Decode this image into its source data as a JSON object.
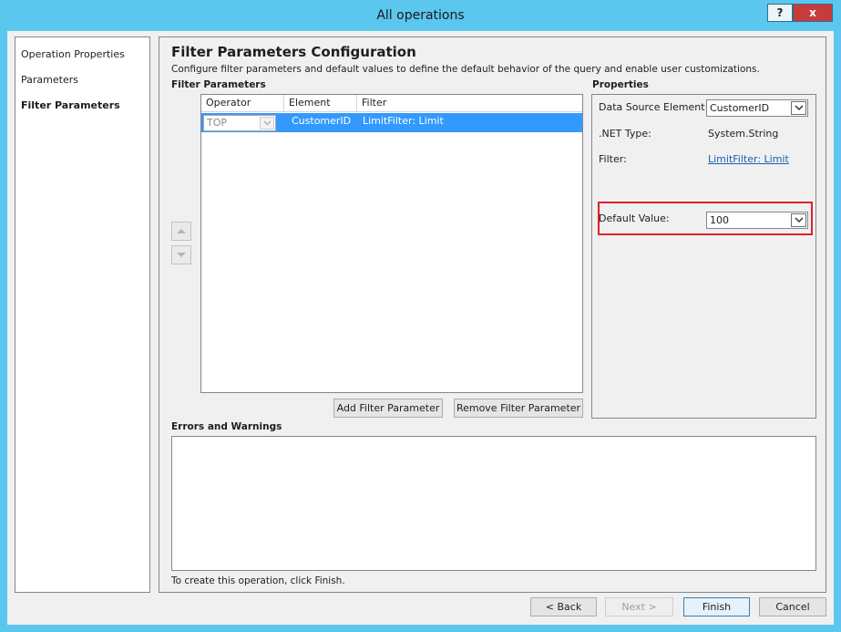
{
  "window": {
    "title": "All operations",
    "help_label": "?",
    "close_label": "x"
  },
  "nav": {
    "items": [
      {
        "label": "Operation Properties"
      },
      {
        "label": "Parameters"
      },
      {
        "label": "Filter Parameters"
      }
    ]
  },
  "page": {
    "title": "Filter Parameters Configuration",
    "description": "Configure filter parameters and default values to define the default behavior of the query and enable user customizations."
  },
  "filter_parameters": {
    "label": "Filter Parameters",
    "columns": [
      "Operator",
      "Element",
      "Filter"
    ],
    "rows": [
      {
        "operator": "TOP",
        "element": "CustomerID",
        "filter": "LimitFilter: Limit"
      }
    ],
    "add_label": "Add Filter Parameter",
    "remove_label": "Remove Filter Parameter"
  },
  "properties": {
    "label": "Properties",
    "data_source_element_label": "Data Source Element:",
    "data_source_element_value": "CustomerID",
    "net_type_label": ".NET Type:",
    "net_type_value": "System.String",
    "filter_label": "Filter:",
    "filter_value": "LimitFilter: Limit",
    "default_value_label": "Default Value:",
    "default_value": "100"
  },
  "errors": {
    "label": "Errors and Warnings"
  },
  "footer": {
    "hint": "To create this operation, click Finish.",
    "back_label": "< Back",
    "next_label": "Next >",
    "finish_label": "Finish",
    "cancel_label": "Cancel"
  },
  "colors": {
    "title_bar": "#5bc6ee",
    "selection": "#3399ff",
    "highlight_border": "#e0212b",
    "link": "#1a5fb4"
  }
}
